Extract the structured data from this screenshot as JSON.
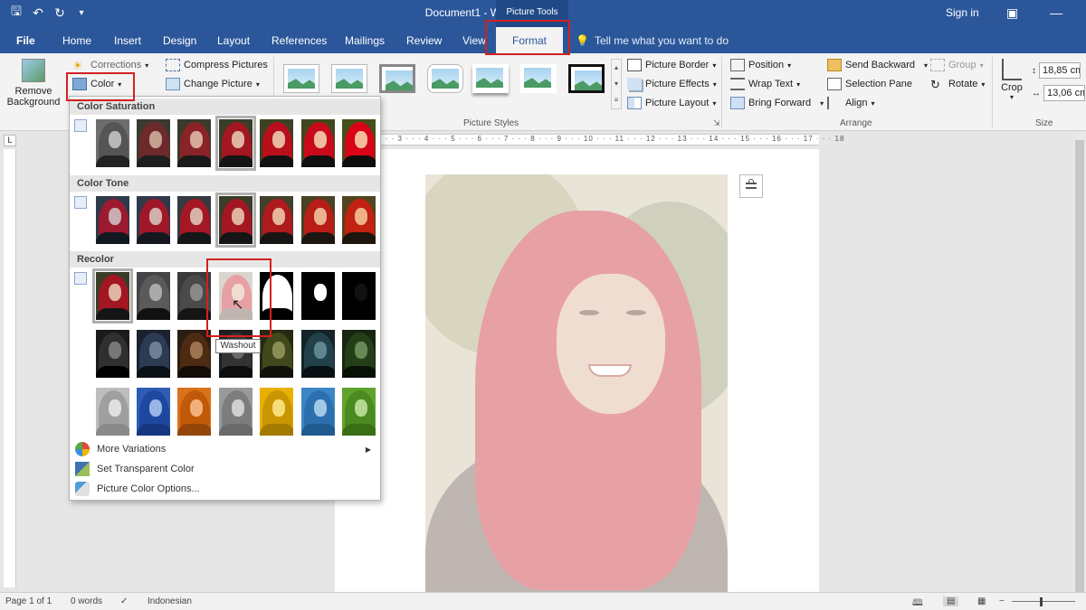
{
  "titlebar": {
    "doc_title": "Document1  -  Word",
    "picture_tools": "Picture Tools",
    "sign_in": "Sign in"
  },
  "tabs": [
    "File",
    "Home",
    "Insert",
    "Design",
    "Layout",
    "References",
    "Mailings",
    "Review",
    "View"
  ],
  "active_tab": "Format",
  "tell_me": "Tell me what you want to do",
  "ribbon": {
    "remove_background_1": "Remove",
    "remove_background_2": "Background",
    "corrections": "Corrections",
    "color": "Color",
    "compress_pictures": "Compress Pictures",
    "change_picture": "Change Picture",
    "picture_border": "Picture Border",
    "picture_effects": "Picture Effects",
    "picture_layout": "Picture Layout",
    "picture_styles": "Picture Styles",
    "position": "Position",
    "wrap_text": "Wrap Text",
    "bring_forward": "Bring Forward",
    "send_backward": "Send Backward",
    "selection_pane": "Selection Pane",
    "align": "Align",
    "group": "Group",
    "rotate": "Rotate",
    "arrange": "Arrange",
    "crop": "Crop",
    "size": "Size",
    "height": "18,85 cm",
    "width": "13,06 cm"
  },
  "color_menu": {
    "color_saturation": "Color Saturation",
    "color_tone": "Color Tone",
    "recolor": "Recolor",
    "more_variations": "More Variations",
    "set_transparent_color": "Set Transparent Color",
    "picture_color_options": "Picture Color Options...",
    "tooltip": "Washout"
  },
  "ruler": {
    "marks": "· 1 · · · 2 · · · 3 · · · 4 · · · 5 · · · 6 · · · 7 · · · 8 · · · 9 · · · 10 · · · 11 · · · 12 · · · 13 · · · 14 · · · 15 · · · 16 · · · 17 · · · 18"
  },
  "statusbar": {
    "page": "Page 1 of 1",
    "words": "0 words",
    "language": "Indonesian"
  },
  "colors": {
    "word_blue": "#2b579a",
    "highlight_red": "#d42020",
    "hijab_red": "#a31722"
  }
}
